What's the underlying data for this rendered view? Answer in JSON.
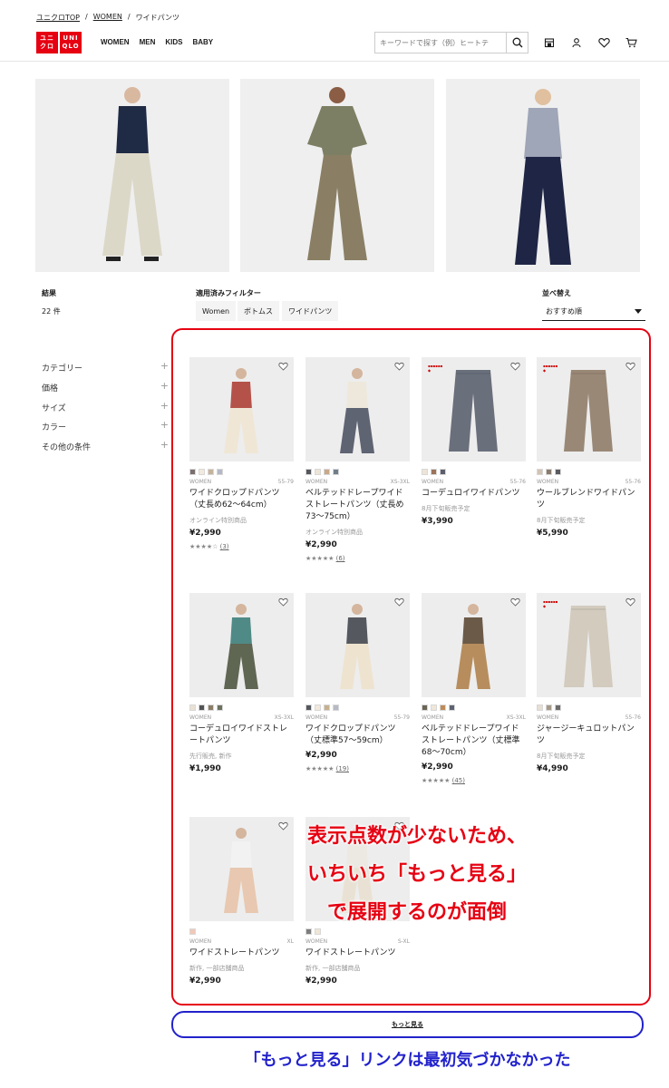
{
  "breadcrumb": [
    "ユニクロTOP",
    "WOMEN",
    "ワイドパンツ"
  ],
  "brand": {
    "logo_left": "ユニ クロ",
    "logo_right": "UNI QLO",
    "color": "#e60012"
  },
  "nav": [
    "WOMEN",
    "MEN",
    "KIDS",
    "BABY"
  ],
  "search": {
    "placeholder": "キーワードで探す（例）ヒートテ"
  },
  "header_icons": [
    "store-icon",
    "user-icon",
    "heart-icon",
    "cart-icon"
  ],
  "results": {
    "label": "結果",
    "count": "22 件"
  },
  "filters": {
    "label": "適用済みフィルター",
    "chips": [
      "Women",
      "ボトムス",
      "ワイドパンツ"
    ]
  },
  "sort": {
    "label": "並べ替え",
    "value": "おすすめ順"
  },
  "sidebar": [
    "カテゴリー",
    "価格",
    "サイズ",
    "カラー",
    "その他の条件"
  ],
  "products": [
    {
      "gender": "WOMEN",
      "size": "55-79",
      "name": "ワイドクロップドパンツ（丈長め62～64cm）",
      "note": "オンライン特別商品",
      "price": "¥2,990",
      "stars": "★★★★☆",
      "reviews": "(3)",
      "colors": [
        "#7b6f6d",
        "#f3e9dc",
        "#c7b39b",
        "#b5b8c5"
      ]
    },
    {
      "gender": "WOMEN",
      "size": "XS-3XL",
      "name": "ベルテッドドレープワイドストレートパンツ（丈長め73～75cm）",
      "note": "オンライン特別商品",
      "price": "¥2,990",
      "stars": "★★★★★",
      "reviews": "(6)",
      "colors": [
        "#55575d",
        "#eee4d6",
        "#c9a98a",
        "#6f7f8a"
      ]
    },
    {
      "gender": "WOMEN",
      "size": "55-76",
      "name": "コーデュロイワイドパンツ",
      "note": "8月下旬販売予定",
      "price": "¥3,990",
      "stars": "",
      "reviews": "",
      "colors": [
        "#eee5d8",
        "#9d7359",
        "#5c5f6b"
      ]
    },
    {
      "gender": "WOMEN",
      "size": "55-76",
      "name": "ウールブレンドワイドパンツ",
      "note": "8月下旬販売予定",
      "price": "¥5,990",
      "stars": "",
      "reviews": "",
      "colors": [
        "#d2c3b3",
        "#8a7b6c",
        "#5b5b5f"
      ]
    },
    {
      "gender": "WOMEN",
      "size": "XS-3XL",
      "name": "コーデュロイワイドストレートパンツ",
      "note": "先行販売, 新作",
      "price": "¥1,990",
      "stars": "",
      "reviews": "",
      "colors": [
        "#eae1d3",
        "#525354",
        "#8b7d66",
        "#6b7260"
      ]
    },
    {
      "gender": "WOMEN",
      "size": "55-79",
      "name": "ワイドクロップドパンツ（丈標準57～59cm）",
      "note": "",
      "price": "¥2,990",
      "stars": "★★★★★",
      "reviews": "(19)",
      "colors": [
        "#55575d",
        "#f2e9dc",
        "#c7b08f",
        "#b6bac4"
      ]
    },
    {
      "gender": "WOMEN",
      "size": "XS-3XL",
      "name": "ベルテッドドレープワイドストレートパンツ（丈標準68～70cm）",
      "note": "",
      "price": "¥2,990",
      "stars": "★★★★★",
      "reviews": "(45)",
      "colors": [
        "#6b6558",
        "#efe6d9",
        "#bd8b58",
        "#5d6470"
      ]
    },
    {
      "gender": "WOMEN",
      "size": "55-76",
      "name": "ジャージーキュロットパンツ",
      "note": "8月下旬販売予定",
      "price": "¥4,990",
      "stars": "",
      "reviews": "",
      "colors": [
        "#e6dfd3",
        "#a59a8a",
        "#6c6c6c"
      ]
    },
    {
      "gender": "WOMEN",
      "size": "XL",
      "name": "ワイドストレートパンツ",
      "note": "新作, 一部店舗商品",
      "price": "¥2,990",
      "stars": "",
      "reviews": "",
      "colors": [
        "#f0c9b8"
      ]
    },
    {
      "gender": "WOMEN",
      "size": "S-XL",
      "name": "ワイドストレートパンツ",
      "note": "新作, 一部店舗商品",
      "price": "¥2,990",
      "stars": "",
      "reviews": "",
      "colors": [
        "#7d7d7d",
        "#efe6d6"
      ]
    }
  ],
  "more_link": "もっと見る",
  "annotation_red": [
    "表示点数が少ないため、",
    "いちいち「もっと見る」",
    "で展開するのが面倒"
  ],
  "annotation_blue": "「もっと見る」リンクは最初気づかなかった"
}
